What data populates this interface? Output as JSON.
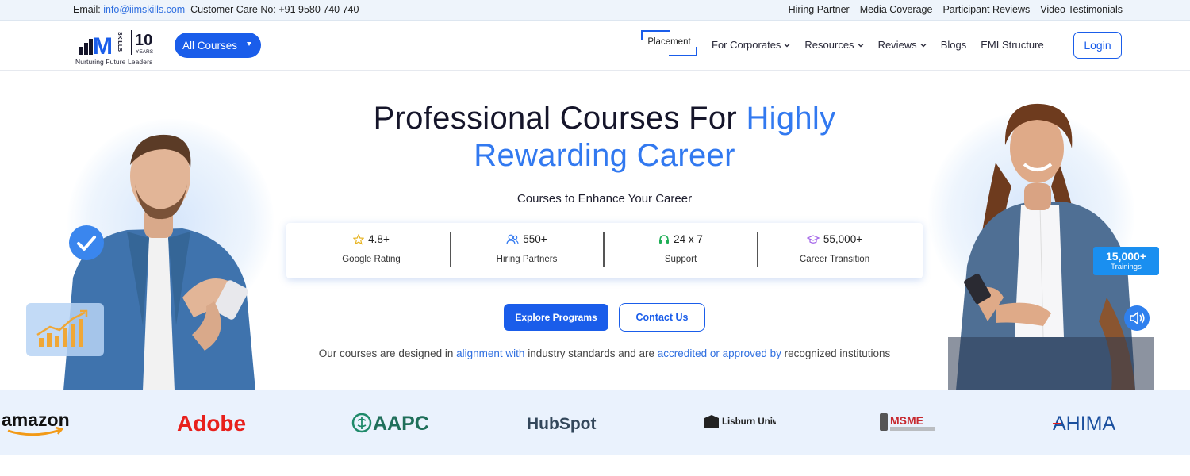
{
  "topbar": {
    "email_label": "Email: ",
    "email": "info@iimskills.com",
    "care_label": "Customer Care No:",
    "care_number": "+91 9580 740 740",
    "links": [
      "Hiring Partner",
      "Media Coverage",
      "Participant Reviews",
      "Video Testimonials"
    ]
  },
  "nav": {
    "logo_letter": "M",
    "logo_vertical": "SKILLS",
    "logo_years_num": "10",
    "logo_years_word": "YEARS",
    "logo_tagline": "Nurturing Future Leaders",
    "all_courses": "All Courses",
    "placement": "Placement",
    "menu": [
      {
        "label": "For Corporates",
        "has_dropdown": true
      },
      {
        "label": "Resources",
        "has_dropdown": true
      },
      {
        "label": "Reviews",
        "has_dropdown": true
      },
      {
        "label": "Blogs",
        "has_dropdown": false
      },
      {
        "label": "EMI Structure",
        "has_dropdown": false
      }
    ],
    "login": "Login"
  },
  "hero": {
    "title_line1": "Professional Courses For ",
    "title_highlight1": "Highly",
    "title_line2": "Rewarding Career",
    "subtitle": "Courses to Enhance Your Career",
    "stats": [
      {
        "icon": "star-icon",
        "value": "4.8+",
        "label": "Google Rating",
        "color": "#e8b422"
      },
      {
        "icon": "users-icon",
        "value": "550+",
        "label": "Hiring Partners",
        "color": "#3279f0"
      },
      {
        "icon": "headset-icon",
        "value": "24 x 7",
        "label": "Support",
        "color": "#1fae56"
      },
      {
        "icon": "graduation-cap-icon",
        "value": "55,000+",
        "label": "Career Transition",
        "color": "#a160e8"
      }
    ],
    "explore_button": "Explore Programs",
    "contact_button": "Contact Us",
    "note_parts": [
      "Our courses are designed in ",
      "alignment with",
      " industry standards and are ",
      "accredited or approved by",
      " recognized institutions"
    ],
    "trainings_value": "15,000+",
    "trainings_label": "Trainings"
  },
  "logos": [
    "amazon",
    "Adobe",
    "AAPC",
    "HubSpot",
    "Lisburn University",
    "MSME",
    "AHIMA"
  ],
  "colors": {
    "primary": "#1a5dea",
    "highlight": "#3279f0",
    "logo_strip": "#eaf2fd"
  }
}
